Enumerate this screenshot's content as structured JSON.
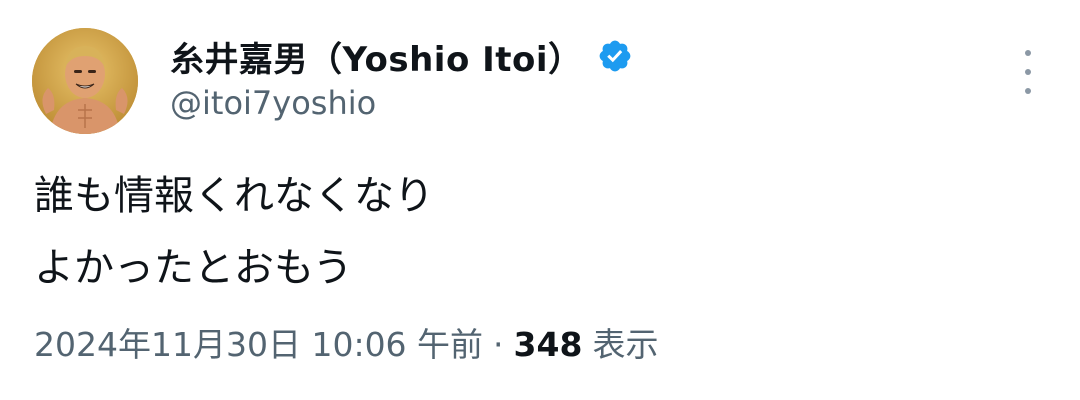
{
  "author": {
    "display_name": "糸井嘉男（Yoshio Itoi）",
    "handle": "@itoi7yoshio",
    "verified_icon": "verified-badge-icon",
    "verified_color": "#1d9bf0"
  },
  "tweet": {
    "lines": [
      "誰も情報くれなくなり",
      "よかったとおもう"
    ]
  },
  "meta": {
    "timestamp": "2024年11月30日 10:06 午前",
    "separator": "·",
    "views_count": "348",
    "views_label": "表示"
  },
  "icons": {
    "more": "more-vertical-icon",
    "avatar": "avatar-image"
  },
  "colors": {
    "text_primary": "#0f1419",
    "text_secondary": "#536471",
    "accent": "#1d9bf0"
  }
}
